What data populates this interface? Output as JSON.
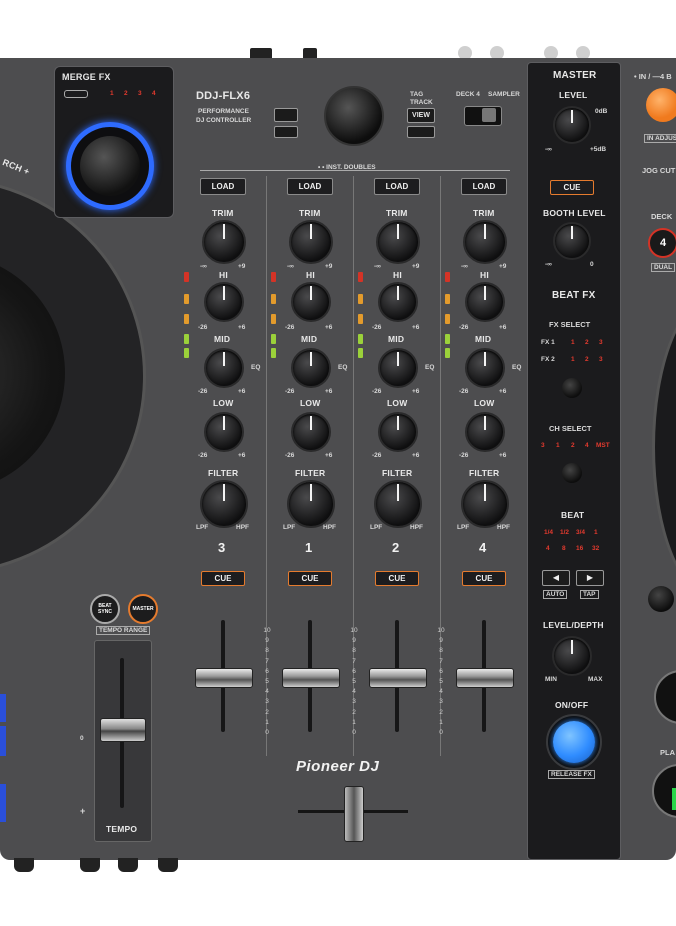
{
  "image": {
    "subject": "dj-controller-photo"
  },
  "brand": {
    "logo": "Pioneer DJ"
  },
  "model": {
    "name": "DDJ-FLX6",
    "subtitle_line1": "PERFORMANCE",
    "subtitle_line2": "DJ CONTROLLER"
  },
  "merge_fx": {
    "label": "MERGE FX",
    "numbers": [
      "1",
      "2",
      "3",
      "4"
    ]
  },
  "search_label": "RCH +",
  "browse": {
    "tag_track": "TAG",
    "tag_track2": "TRACK",
    "view": "VIEW",
    "deck4": "DECK 4",
    "sampler": "SAMPLER",
    "inst_doubles": "• • INST. DOUBLES"
  },
  "channels": [
    {
      "number": "3",
      "load": "LOAD",
      "cue": "CUE"
    },
    {
      "number": "1",
      "load": "LOAD",
      "cue": "CUE"
    },
    {
      "number": "2",
      "load": "LOAD",
      "cue": "CUE"
    },
    {
      "number": "4",
      "load": "LOAD",
      "cue": "CUE"
    }
  ],
  "eq_labels": {
    "trim": "TRIM",
    "hi": "HI",
    "mid": "MID",
    "low": "LOW",
    "filter": "FILTER",
    "eq": "EQ",
    "min_trim": "-∞",
    "max_trim": "+9",
    "min_eq": "-26",
    "max_eq": "+6",
    "lpf": "LPF",
    "hpf": "HPF"
  },
  "fader_scale": [
    "10",
    "9",
    "8",
    "7",
    "6",
    "5",
    "4",
    "3",
    "2",
    "1",
    "0"
  ],
  "master": {
    "title": "MASTER",
    "level": "LEVEL",
    "zero_db": "0dB",
    "plus5": "+5dB",
    "minus_inf": "-∞",
    "cue": "CUE",
    "booth_level": "BOOTH LEVEL",
    "booth_min": "-∞",
    "booth_max": "0"
  },
  "beat_fx": {
    "title": "BEAT FX",
    "fx_select": "FX SELECT",
    "fx1": "FX 1",
    "fx2": "FX 2",
    "fx_nums": [
      "1",
      "2",
      "3"
    ],
    "ch_select": "CH SELECT",
    "ch_nums": [
      "3",
      "1",
      "2",
      "4",
      "MST"
    ],
    "beat": "BEAT",
    "beat_row1": [
      "1/4",
      "1/2",
      "3/4",
      "1"
    ],
    "beat_row2": [
      "4",
      "8",
      "16",
      "32"
    ],
    "auto": "AUTO",
    "tap": "TAP",
    "level_depth": "LEVEL/DEPTH",
    "min": "MIN",
    "max": "MAX",
    "on_off": "ON/OFF",
    "release_fx": "RELEASE FX"
  },
  "left_deck": {
    "beat_sync": "BEAT SYNC",
    "master": "MASTER",
    "tempo_range": "TEMPO RANGE",
    "tempo": "TEMPO",
    "zero": "0",
    "plus": "+"
  },
  "right_deck": {
    "in_out": "• IN / —4 B",
    "in_adjust": "IN ADJUS",
    "jog_cutter": "JOG CUT",
    "deck_label": "DECK",
    "deck_num": "4",
    "dual": "DUAL",
    "play": "PLA"
  },
  "colors": {
    "body": "#4d4d4f",
    "accent_orange": "#e57b2e",
    "led_red": "#e33a2e",
    "jog_ring_blue": "#2e6bff",
    "fx_button_blue": "#2f8cff"
  }
}
